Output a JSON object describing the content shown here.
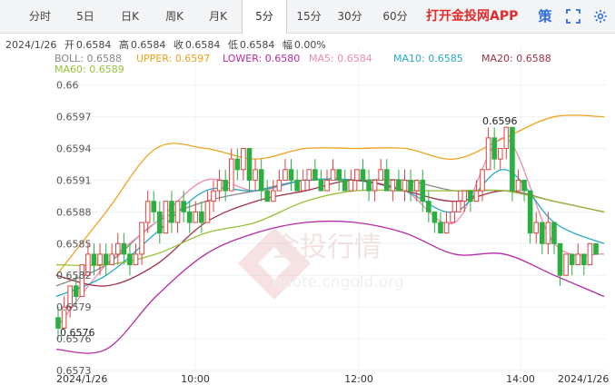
{
  "tabs": [
    {
      "label": "分时",
      "active": false
    },
    {
      "label": "5日",
      "active": false
    },
    {
      "label": "日K",
      "active": false
    },
    {
      "label": "周K",
      "active": false
    },
    {
      "label": "月K",
      "active": false
    },
    {
      "label": "5分",
      "active": true
    },
    {
      "label": "15分",
      "active": false
    },
    {
      "label": "30分",
      "active": false
    },
    {
      "label": "60分",
      "active": false
    }
  ],
  "brand": "打开金投网APP",
  "controls": {
    "strategy_label": "策",
    "fullscreen_icon": "fullscreen-icon",
    "settings_icon": "gear-icon"
  },
  "info": {
    "date": "2024/1/26",
    "open_label": "开",
    "open": "0.6584",
    "high_label": "高",
    "high": "0.6584",
    "close_label": "收",
    "close": "0.6584",
    "low_label": "低",
    "low": "0.6584",
    "amp_label": "幅",
    "amp": "0.00%"
  },
  "legend": [
    {
      "label": "BOLL: 0.6588",
      "color": "#888888"
    },
    {
      "label": "UPPER: 0.6597",
      "color": "#f0a21a"
    },
    {
      "label": "LOWER: 0.6580",
      "color": "#b72aa8"
    },
    {
      "label": "MA5: 0.6584",
      "color": "#f08ab4"
    },
    {
      "label": "MA10: 0.6585",
      "color": "#28a7c8"
    },
    {
      "label": "MA20: 0.6588",
      "color": "#a03048"
    },
    {
      "label": "MA60: 0.6589",
      "color": "#98c23a"
    }
  ],
  "watermark": {
    "cn": "金投行情",
    "en": "quote.cngold.org"
  },
  "chart_data": {
    "type": "candlestick",
    "y_ticks": [
      "0.6573",
      "0.6576",
      "0.6579",
      "0.6582",
      "0.6585",
      "0.6588",
      "0.6591",
      "0.6594",
      "0.6597",
      "0.66"
    ],
    "x_labels": [
      "2024/1/26",
      "10:00",
      "12:00",
      "14:00",
      "2024/1/26"
    ],
    "annotations": [
      {
        "label": "0.6596",
        "value": 0.6596
      },
      {
        "label": "0.6576",
        "value": 0.6576
      }
    ],
    "colors": {
      "up": "#e04040",
      "down": "#2bb040"
    },
    "candles": [
      [
        0.6578,
        0.6577,
        0.6579,
        0.6576
      ],
      [
        0.6577,
        0.6579,
        0.658,
        0.6577
      ],
      [
        0.6579,
        0.6581,
        0.6581,
        0.6578
      ],
      [
        0.6581,
        0.658,
        0.6582,
        0.6579
      ],
      [
        0.658,
        0.6583,
        0.6583,
        0.658
      ],
      [
        0.6582,
        0.6584,
        0.6585,
        0.6582
      ],
      [
        0.6584,
        0.6583,
        0.6585,
        0.6582
      ],
      [
        0.6583,
        0.6584,
        0.6585,
        0.6582
      ],
      [
        0.6584,
        0.6583,
        0.6585,
        0.6582
      ],
      [
        0.6583,
        0.6584,
        0.6585,
        0.6583
      ],
      [
        0.6584,
        0.6585,
        0.6586,
        0.6583
      ],
      [
        0.6585,
        0.6584,
        0.6586,
        0.6583
      ],
      [
        0.6584,
        0.6583,
        0.6585,
        0.6582
      ],
      [
        0.6583,
        0.6584,
        0.6585,
        0.6583
      ],
      [
        0.6584,
        0.6587,
        0.6587,
        0.6583
      ],
      [
        0.6587,
        0.6589,
        0.659,
        0.6586
      ],
      [
        0.6589,
        0.6588,
        0.659,
        0.6587
      ],
      [
        0.6588,
        0.6586,
        0.6589,
        0.6585
      ],
      [
        0.6586,
        0.6589,
        0.6589,
        0.6586
      ],
      [
        0.6589,
        0.6587,
        0.659,
        0.6586
      ],
      [
        0.6587,
        0.6589,
        0.6589,
        0.6586
      ],
      [
        0.6589,
        0.6588,
        0.659,
        0.6587
      ],
      [
        0.6588,
        0.6587,
        0.6589,
        0.6586
      ],
      [
        0.6587,
        0.6588,
        0.6589,
        0.6587
      ],
      [
        0.6588,
        0.6587,
        0.6589,
        0.6586
      ],
      [
        0.6587,
        0.6589,
        0.659,
        0.6587
      ],
      [
        0.6589,
        0.659,
        0.6591,
        0.6588
      ],
      [
        0.659,
        0.6591,
        0.6592,
        0.6589
      ],
      [
        0.6591,
        0.659,
        0.6592,
        0.6589
      ],
      [
        0.659,
        0.6593,
        0.6594,
        0.659
      ],
      [
        0.6593,
        0.6592,
        0.6594,
        0.6591
      ],
      [
        0.6592,
        0.6594,
        0.6594,
        0.6591
      ],
      [
        0.6594,
        0.6591,
        0.6594,
        0.659
      ],
      [
        0.6591,
        0.6592,
        0.6593,
        0.659
      ],
      [
        0.6592,
        0.659,
        0.6593,
        0.6589
      ],
      [
        0.659,
        0.6589,
        0.6591,
        0.6589
      ],
      [
        0.6589,
        0.659,
        0.6591,
        0.6589
      ],
      [
        0.659,
        0.6591,
        0.6592,
        0.659
      ],
      [
        0.6591,
        0.6592,
        0.6593,
        0.6591
      ],
      [
        0.6592,
        0.6591,
        0.6593,
        0.659
      ],
      [
        0.6591,
        0.659,
        0.6592,
        0.659
      ],
      [
        0.659,
        0.6591,
        0.6592,
        0.659
      ],
      [
        0.6591,
        0.6592,
        0.6592,
        0.659
      ],
      [
        0.6592,
        0.6591,
        0.6593,
        0.6591
      ],
      [
        0.6591,
        0.659,
        0.6592,
        0.659
      ],
      [
        0.659,
        0.6591,
        0.6592,
        0.659
      ],
      [
        0.6591,
        0.6592,
        0.6593,
        0.6591
      ],
      [
        0.6592,
        0.6591,
        0.6592,
        0.659
      ],
      [
        0.6591,
        0.659,
        0.6592,
        0.659
      ],
      [
        0.659,
        0.6591,
        0.6592,
        0.659
      ],
      [
        0.6591,
        0.6592,
        0.6592,
        0.659
      ],
      [
        0.6592,
        0.6591,
        0.6593,
        0.659
      ],
      [
        0.6591,
        0.659,
        0.6592,
        0.6589
      ],
      [
        0.659,
        0.6591,
        0.6591,
        0.6589
      ],
      [
        0.6591,
        0.6592,
        0.6593,
        0.6591
      ],
      [
        0.6592,
        0.659,
        0.6593,
        0.659
      ],
      [
        0.659,
        0.6591,
        0.6591,
        0.6589
      ],
      [
        0.6591,
        0.659,
        0.6592,
        0.659
      ],
      [
        0.659,
        0.6591,
        0.6592,
        0.6589
      ],
      [
        0.6591,
        0.659,
        0.6592,
        0.6589
      ],
      [
        0.659,
        0.6591,
        0.6591,
        0.6589
      ],
      [
        0.6591,
        0.6589,
        0.6592,
        0.6588
      ],
      [
        0.6589,
        0.6588,
        0.659,
        0.6587
      ],
      [
        0.6588,
        0.6587,
        0.6588,
        0.6586
      ],
      [
        0.6587,
        0.6586,
        0.6588,
        0.6586
      ],
      [
        0.6586,
        0.6587,
        0.6588,
        0.6586
      ],
      [
        0.6587,
        0.6588,
        0.6589,
        0.6587
      ],
      [
        0.6588,
        0.6589,
        0.659,
        0.6588
      ],
      [
        0.6589,
        0.659,
        0.659,
        0.6588
      ],
      [
        0.659,
        0.6589,
        0.659,
        0.6588
      ],
      [
        0.6589,
        0.659,
        0.6591,
        0.6589
      ],
      [
        0.659,
        0.6592,
        0.6592,
        0.6589
      ],
      [
        0.6592,
        0.6595,
        0.6596,
        0.6592
      ],
      [
        0.6595,
        0.6593,
        0.6596,
        0.6592
      ],
      [
        0.6593,
        0.6594,
        0.6594,
        0.6592
      ],
      [
        0.6594,
        0.6596,
        0.6596,
        0.6593
      ],
      [
        0.6596,
        0.659,
        0.6596,
        0.6589
      ],
      [
        0.659,
        0.6591,
        0.6592,
        0.659
      ],
      [
        0.6591,
        0.659,
        0.6591,
        0.6589
      ],
      [
        0.659,
        0.6586,
        0.659,
        0.6585
      ],
      [
        0.6586,
        0.6587,
        0.6588,
        0.6585
      ],
      [
        0.6587,
        0.6585,
        0.6587,
        0.6584
      ],
      [
        0.6585,
        0.6587,
        0.6588,
        0.6584
      ],
      [
        0.6587,
        0.6585,
        0.6587,
        0.6584
      ],
      [
        0.6585,
        0.6582,
        0.6585,
        0.6581
      ],
      [
        0.6582,
        0.6584,
        0.6584,
        0.6582
      ],
      [
        0.6584,
        0.6583,
        0.6584,
        0.6582
      ],
      [
        0.6583,
        0.6584,
        0.6585,
        0.6583
      ],
      [
        0.6584,
        0.6583,
        0.6584,
        0.6582
      ],
      [
        0.6583,
        0.6585,
        0.6585,
        0.6583
      ],
      [
        0.6585,
        0.6584,
        0.6585,
        0.6584
      ]
    ],
    "series": [
      {
        "name": "UPPER",
        "color": "#f0a21a",
        "values": [
          0.6582,
          0.6588,
          0.6594,
          0.6594,
          0.6593,
          0.6594,
          0.6594,
          0.6594,
          0.6593,
          0.6595,
          0.6597,
          0.6597
        ]
      },
      {
        "name": "BOLL",
        "color": "#888888",
        "values": [
          0.6581,
          0.6583,
          0.6587,
          0.6589,
          0.659,
          0.6591,
          0.6591,
          0.6591,
          0.659,
          0.659,
          0.6589,
          0.6588
        ]
      },
      {
        "name": "LOWER",
        "color": "#b72aa8",
        "values": [
          0.6575,
          0.6575,
          0.658,
          0.6584,
          0.6586,
          0.6587,
          0.6587,
          0.6586,
          0.6584,
          0.6584,
          0.6582,
          0.658
        ]
      },
      {
        "name": "MA5",
        "color": "#f08ab4",
        "values": [
          0.6577,
          0.6583,
          0.6587,
          0.6591,
          0.659,
          0.6591,
          0.6591,
          0.659,
          0.6587,
          0.6595,
          0.6585,
          0.6584
        ]
      },
      {
        "name": "MA10",
        "color": "#28a7c8",
        "values": [
          0.658,
          0.6582,
          0.6586,
          0.659,
          0.659,
          0.6591,
          0.6591,
          0.659,
          0.6588,
          0.6592,
          0.6587,
          0.6585
        ]
      },
      {
        "name": "MA20",
        "color": "#a03048",
        "values": [
          0.6582,
          0.6581,
          0.6583,
          0.6587,
          0.6589,
          0.659,
          0.6591,
          0.659,
          0.6589,
          0.659,
          0.6589,
          0.6588
        ]
      },
      {
        "name": "MA60",
        "color": "#98c23a",
        "values": [
          0.6583,
          0.6583,
          0.6584,
          0.6586,
          0.6587,
          0.6589,
          0.659,
          0.659,
          0.659,
          0.659,
          0.6589,
          0.6588
        ]
      }
    ],
    "y_range": [
      0.6573,
      0.6601
    ]
  }
}
